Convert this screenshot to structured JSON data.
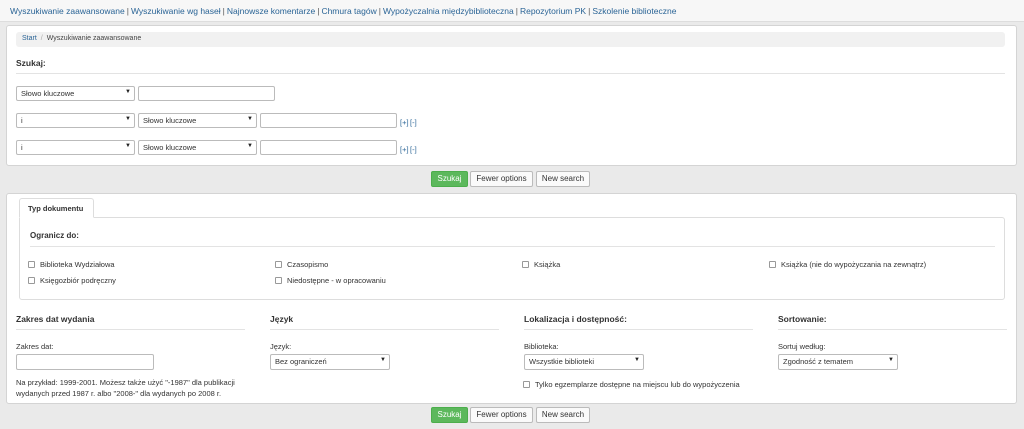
{
  "topnav": {
    "links": [
      "Wyszukiwanie zaawansowane",
      "Wyszukiwanie wg haseł",
      "Najnowsze komentarze",
      "Chmura tagów",
      "Wypożyczalnia międzybiblioteczna",
      "Repozytorium PK",
      "Szkolenie biblioteczne"
    ],
    "separator": "|"
  },
  "breadcrumb": {
    "start": "Start",
    "separator": "/",
    "current": "Wyszukiwanie zaawansowane"
  },
  "search": {
    "heading": "Szukaj:",
    "rows": [
      {
        "field": "Słowo kluczowe",
        "value": ""
      },
      {
        "operator": "i",
        "field": "Słowo kluczowe",
        "value": "",
        "add": "[+]",
        "remove": "[-]"
      },
      {
        "operator": "i",
        "field": "Słowo kluczowe",
        "value": "",
        "add": "[+]",
        "remove": "[-]"
      }
    ]
  },
  "buttons": {
    "search": "Szukaj",
    "fewer": "Fewer options",
    "new": "New search"
  },
  "limits": {
    "tab": "Typ dokumentu",
    "heading": "Ogranicz do:",
    "checkboxes": [
      "Biblioteka Wydziałowa",
      "Czasopismo",
      "Książka",
      "Książka (nie do wypożyczania na zewnątrz)",
      "Księgozbiór podręczny",
      "Niedostępne - w opracowaniu"
    ]
  },
  "date": {
    "heading": "Zakres dat wydania",
    "label": "Zakres dat:",
    "value": "",
    "hint": "Na przykład: 1999-2001. Możesz także użyć \"-1987\" dla publikacji wydanych przed 1987 r. albo \"2008-\" dla wydanych po 2008 r."
  },
  "language": {
    "heading": "Język",
    "label": "Język:",
    "selected": "Bez ograniczeń"
  },
  "location": {
    "heading": "Lokalizacja i dostępność:",
    "label": "Biblioteka:",
    "selected": "Wszystkie biblioteki",
    "checkbox": "Tylko egzemplarze dostępne na miejscu lub do wypożyczenia"
  },
  "sort": {
    "heading": "Sortowanie:",
    "label": "Sortuj według:",
    "selected": "Zgodność z tematem"
  },
  "icons": {
    "dropdown": "chevron-down-icon"
  }
}
